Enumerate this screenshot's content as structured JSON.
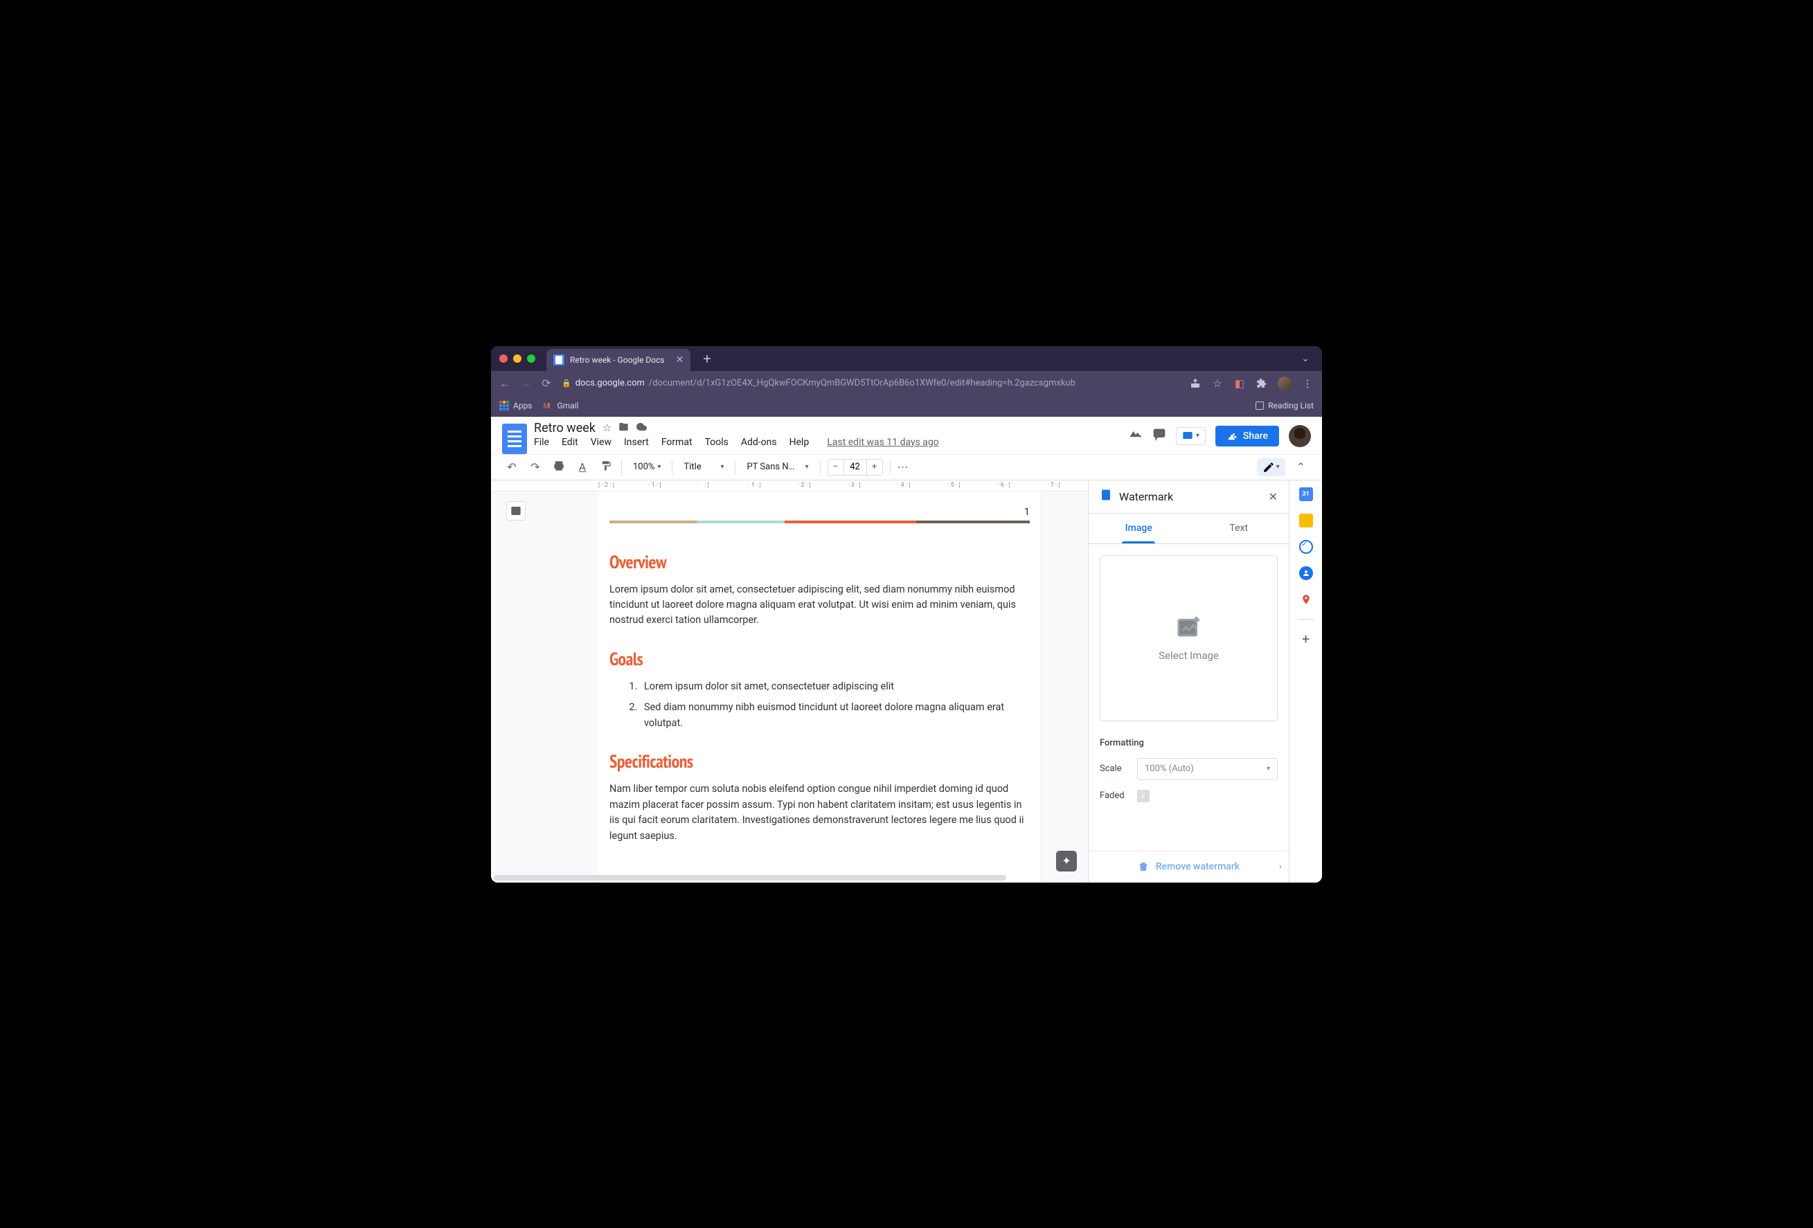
{
  "browser": {
    "tab_title": "Retro week - Google Docs",
    "url_domain": "docs.google.com",
    "url_path": "/document/d/1xG1zOE4X_HgQkwFOCKmyQmBGWD5TtOrAp6B6o1XWfe0/edit#heading=h.2gazcsgmxkub",
    "bookmarks": {
      "apps": "Apps",
      "gmail": "Gmail",
      "reading_list": "Reading List"
    }
  },
  "app": {
    "doc_title": "Retro week",
    "menus": [
      "File",
      "Edit",
      "View",
      "Insert",
      "Format",
      "Tools",
      "Add-ons",
      "Help"
    ],
    "last_edit": "Last edit was 11 days ago",
    "share": "Share"
  },
  "toolbar": {
    "zoom": "100%",
    "style": "Title",
    "font": "PT Sans N…",
    "font_size": "42"
  },
  "document": {
    "page_num": "1",
    "sections": [
      {
        "heading": "Overview",
        "body": "Lorem ipsum dolor sit amet, consectetuer adipiscing elit, sed diam nonummy nibh euismod tincidunt ut laoreet dolore magna aliquam erat volutpat. Ut wisi enim ad minim veniam, quis nostrud exerci tation ullamcorper."
      },
      {
        "heading": "Goals",
        "list": [
          "Lorem ipsum dolor sit amet, consectetuer adipiscing elit",
          "Sed diam nonummy nibh euismod tincidunt ut laoreet dolore magna aliquam erat volutpat."
        ]
      },
      {
        "heading": "Specifications",
        "body": "Nam liber tempor cum soluta nobis eleifend option congue nihil imperdiet doming id quod mazim placerat facer possim assum. Typi non habent claritatem insitam; est usus legentis in iis qui facit eorum claritatem. Investigationes demonstraverunt lectores legere me lius quod ii legunt saepius."
      }
    ]
  },
  "sidebar": {
    "title": "Watermark",
    "tabs": {
      "image": "Image",
      "text": "Text"
    },
    "select_image": "Select Image",
    "formatting": "Formatting",
    "scale_label": "Scale",
    "scale_value": "100% (Auto)",
    "faded_label": "Faded",
    "remove": "Remove watermark"
  },
  "side_panel": {
    "cal_day": "31"
  }
}
